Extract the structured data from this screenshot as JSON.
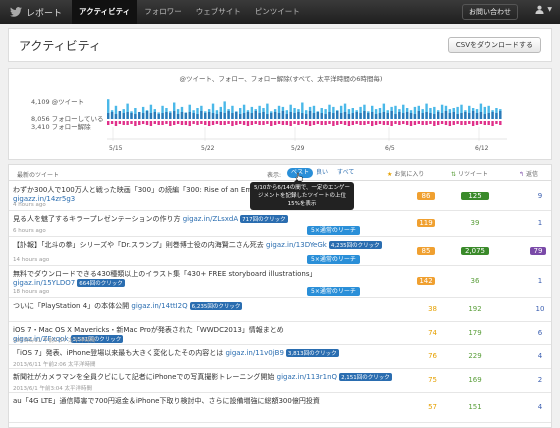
{
  "nav": {
    "brand": "レポート",
    "items": [
      "アクティビティ",
      "フォロワー",
      "ウェブサイト",
      "ピンツイート"
    ],
    "contact": "お問い合わせ"
  },
  "header": {
    "title": "アクティビティ",
    "csv_button": "CSVをダウンロードする"
  },
  "chart": {
    "title": "@ツイート、フォロー、フォロー解除(すべて、太平洋時間の6時間毎)",
    "legend_mentions": "4,109 @ツイート",
    "legend_follows": "8,056 フォローしている",
    "legend_unfollows": "3,410 フォロー解除",
    "x_ticks": [
      "5/15",
      "5/22",
      "5/29",
      "6/5",
      "6/12"
    ]
  },
  "chart_data": {
    "type": "bar",
    "title": "@ツイート、フォロー、フォロー解除(すべて、太平洋時間の6時間毎)",
    "x_ticks": [
      "5/15",
      "5/22",
      "5/29",
      "6/5",
      "6/12"
    ],
    "series": [
      {
        "name": "@ツイート",
        "total": 4109,
        "color": "#4ab8e8",
        "values": [
          18,
          8,
          12,
          6,
          9,
          14,
          7,
          10,
          5,
          11,
          8,
          13,
          9,
          6,
          12,
          10,
          7,
          15,
          9,
          11,
          6,
          13,
          8,
          10,
          12,
          7,
          9,
          14,
          8,
          11,
          16,
          9,
          12,
          7,
          10,
          13,
          8,
          11,
          9,
          12,
          10,
          14,
          7,
          9,
          12,
          11,
          8,
          13,
          10,
          9,
          15,
          8,
          11,
          12,
          7,
          10,
          9,
          13,
          11,
          8,
          12,
          14,
          9,
          10,
          8,
          11,
          13,
          7,
          12,
          9,
          10,
          14,
          8,
          11,
          12,
          9,
          13,
          10,
          8,
          11,
          12,
          9,
          14,
          10,
          11,
          8,
          13,
          12,
          9,
          10,
          11,
          13,
          8,
          12,
          10,
          9,
          14,
          11,
          12,
          8,
          10,
          9
        ]
      },
      {
        "name": "フォローしている",
        "total": 8056,
        "color": "#2a7ab8",
        "values": [
          6,
          7,
          5,
          8,
          6,
          7,
          6,
          5,
          7,
          6,
          8,
          6,
          7,
          5,
          6,
          7,
          6,
          8,
          5,
          7,
          6,
          7,
          6,
          5,
          8,
          6,
          7,
          6,
          5,
          7,
          6,
          8,
          6,
          7,
          5,
          6,
          7,
          6,
          8,
          6,
          7,
          5,
          6,
          7,
          6,
          8,
          5,
          7,
          6,
          7,
          6,
          5,
          8,
          6,
          7,
          6,
          5,
          7,
          6,
          8,
          6,
          7,
          5,
          6,
          7,
          6,
          8,
          6,
          7,
          5,
          6,
          7,
          6,
          8,
          5,
          7,
          6,
          7,
          6,
          5,
          8,
          6,
          7,
          6,
          5,
          7,
          6,
          8,
          6,
          7,
          5,
          6,
          7,
          6,
          8,
          6,
          7,
          5,
          6,
          7,
          6,
          8
        ]
      },
      {
        "name": "フォロー解除",
        "total": 3410,
        "color": "#e0308a",
        "values": [
          4,
          3,
          5,
          3,
          4,
          4,
          3,
          5,
          4,
          3,
          4,
          5,
          3,
          4,
          4,
          3,
          5,
          4,
          3,
          4,
          4,
          5,
          3,
          4,
          3,
          4,
          5,
          4,
          3,
          4,
          4,
          3,
          5,
          4,
          3,
          4,
          5,
          4,
          3,
          4,
          4,
          3,
          5,
          4,
          3,
          4,
          4,
          5,
          3,
          4,
          3,
          4,
          5,
          4,
          3,
          4,
          4,
          3,
          5,
          4,
          3,
          4,
          5,
          4,
          3,
          4,
          4,
          3,
          5,
          4,
          3,
          4,
          4,
          5,
          3,
          4,
          3,
          4,
          5,
          4,
          3,
          4,
          4,
          3,
          5,
          4,
          3,
          4,
          5,
          4,
          3,
          4,
          4,
          3,
          5,
          4,
          3,
          4,
          4,
          5,
          3,
          4
        ]
      }
    ]
  },
  "list": {
    "header_recent": "最新のツイート",
    "header_show": "表示:",
    "filter_best": "ベスト",
    "filter_good": "良い",
    "filter_all": "すべて",
    "col_fav": "お気に入り",
    "col_rt": "リツイート",
    "col_reply": "返信",
    "tooltip": "5/10から6/14の間で、一定のエンゲージメントを記録したツイートの上位15%を表示",
    "reach_label": "5×通常のリーチ",
    "rows": [
      {
        "text": "わずか300人で100万人と戦った映画「300」の続編「300: Rise of an Empire」予告編公開",
        "link": "gigazz.in/14zr5g3",
        "clicks": "",
        "time": "4 hours ago",
        "fav": "86",
        "rt": "125",
        "reply": "9",
        "fav_box": true,
        "rt_box": true,
        "reply_box": false,
        "reach": false
      },
      {
        "text": "見る人を魅了するキラープレゼンテーションの作り方",
        "link": "gigaz.in/ZLsxdA",
        "clicks": "717回のクリック",
        "time": "6 hours ago",
        "fav": "119",
        "rt": "39",
        "reply": "1",
        "fav_box": true,
        "rt_box": false,
        "reply_box": false,
        "reach": true
      },
      {
        "text": "【訃報】「北斗の拳」シリーズや「Dr.スランプ」則巻博士役の内海賢二さん死去",
        "link": "gigaz.in/13DYeGk",
        "clicks": "4,235回のクリック",
        "time": "14 hours ago",
        "fav": "85",
        "rt": "2,075",
        "reply": "79",
        "fav_box": true,
        "rt_box": true,
        "reply_box": true,
        "reach": true
      },
      {
        "text": "無料でダウンロードできる430種類以上のイラスト集「430+ FREE storyboard illustrations」",
        "link": "gigaz.in/15YLDO7",
        "clicks": "664回のクリック",
        "time": "18 hours ago",
        "fav": "142",
        "rt": "36",
        "reply": "1",
        "fav_box": true,
        "rt_box": false,
        "reply_box": false,
        "reach": true
      },
      {
        "text": "ついに「PlayStation 4」の本体公開",
        "link": "gigaz.in/14ttI2Q",
        "clicks": "6,235回のクリック",
        "time": "",
        "fav": "38",
        "rt": "192",
        "reply": "10",
        "fav_box": false,
        "rt_box": false,
        "reply_box": false,
        "reach": false
      },
      {
        "text": "iOS 7・Mac OS X Mavericks・新Mac Proが発表された「WWDC2013」情報まとめ",
        "link": "gigaz.in/ZFxqok",
        "clicks": "3,581回のクリック",
        "time": "2013/6/11 午前2:57 太平洋時間",
        "fav": "74",
        "rt": "179",
        "reply": "6",
        "fav_box": false,
        "rt_box": false,
        "reply_box": false,
        "reach": false
      },
      {
        "text": "「iOS 7」発表、iPhone登場以来最も大きく変化したその内容とは",
        "link": "gigaz.in/11v0jB9",
        "clicks": "3,813回のクリック",
        "time": "2013/6/11 午前2:06 太平洋時間",
        "fav": "76",
        "rt": "229",
        "reply": "4",
        "fav_box": false,
        "rt_box": false,
        "reply_box": false,
        "reach": false
      },
      {
        "text": "新聞社がカメラマンを全員クビにして記者にiPhoneでの写真撮影トレーニング開始",
        "link": "gigaz.in/113r1nQ",
        "clicks": "2,151回のクリック",
        "time": "2013/6/1 午前3:04 太平洋時間",
        "fav": "75",
        "rt": "169",
        "reply": "2",
        "fav_box": false,
        "rt_box": false,
        "reply_box": false,
        "reach": false
      },
      {
        "text": "au「4G LTE」通信障害で700円返金＆iPhone下取り検討中、さらに設備増強に総額300億円投資",
        "link": "",
        "clicks": "",
        "time": "",
        "fav": "57",
        "rt": "151",
        "reply": "4",
        "fav_box": false,
        "rt_box": false,
        "reply_box": false,
        "reach": false
      }
    ]
  }
}
